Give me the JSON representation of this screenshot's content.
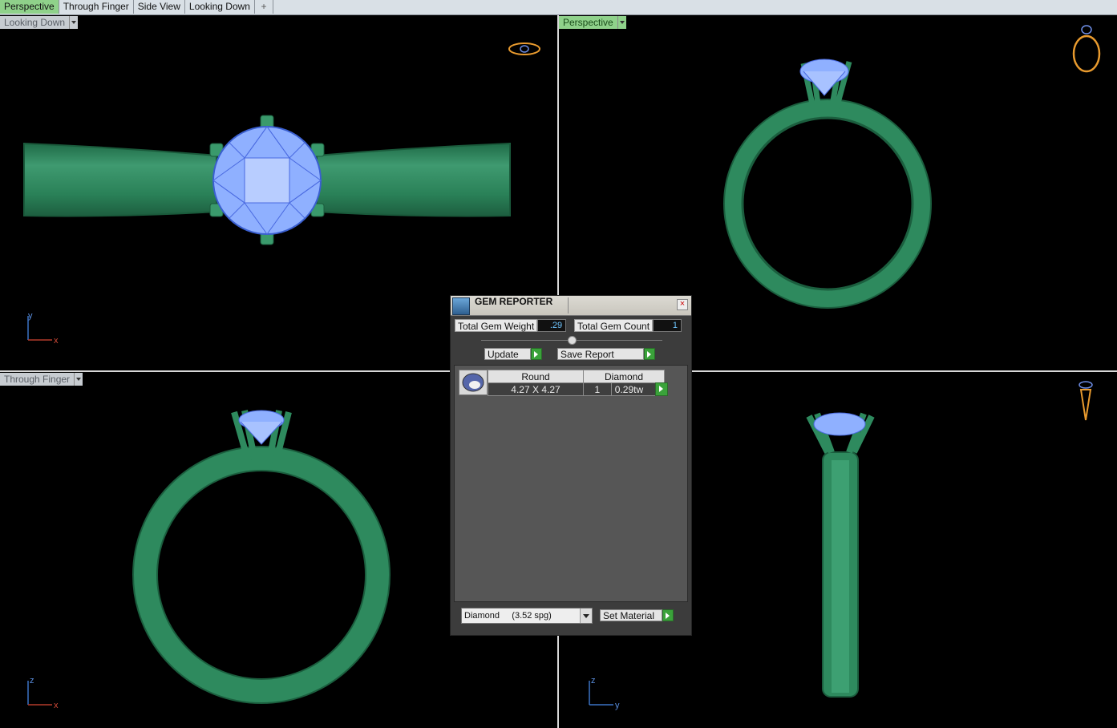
{
  "tabs": [
    {
      "label": "Perspective",
      "active": true
    },
    {
      "label": "Through Finger",
      "active": false
    },
    {
      "label": "Side View",
      "active": false
    },
    {
      "label": "Looking Down",
      "active": false
    }
  ],
  "add_tab_icon": "plus-icon",
  "viewports": {
    "top_left": {
      "label": "Looking Down",
      "axes": {
        "vertical": "y",
        "horizontal": "x"
      }
    },
    "top_right": {
      "label": "Perspective"
    },
    "bottom_left": {
      "label": "Through Finger",
      "axes": {
        "vertical": "z",
        "horizontal": "x"
      }
    },
    "bottom_right": {
      "axes": {
        "vertical": "z",
        "horizontal": "y"
      }
    }
  },
  "gem_reporter": {
    "title": "GEM REPORTER",
    "total_gem_weight_label": "Total Gem Weight",
    "total_gem_weight": ".29",
    "total_gem_count_label": "Total Gem Count",
    "total_gem_count": "1",
    "update_label": "Update",
    "save_report_label": "Save Report",
    "gems": [
      {
        "shape": "Round",
        "size": "4.27 X 4.27",
        "material": "Diamond",
        "count": "1",
        "weight": "0.29tw"
      }
    ],
    "material_select": "Diamond     (3.52 spg)",
    "set_material_label": "Set Material"
  },
  "colors": {
    "tab_active": "#8fd18a",
    "metal": "#2e8a5e",
    "gem": "#8fb0ff",
    "go_button": "#3aa23a"
  }
}
